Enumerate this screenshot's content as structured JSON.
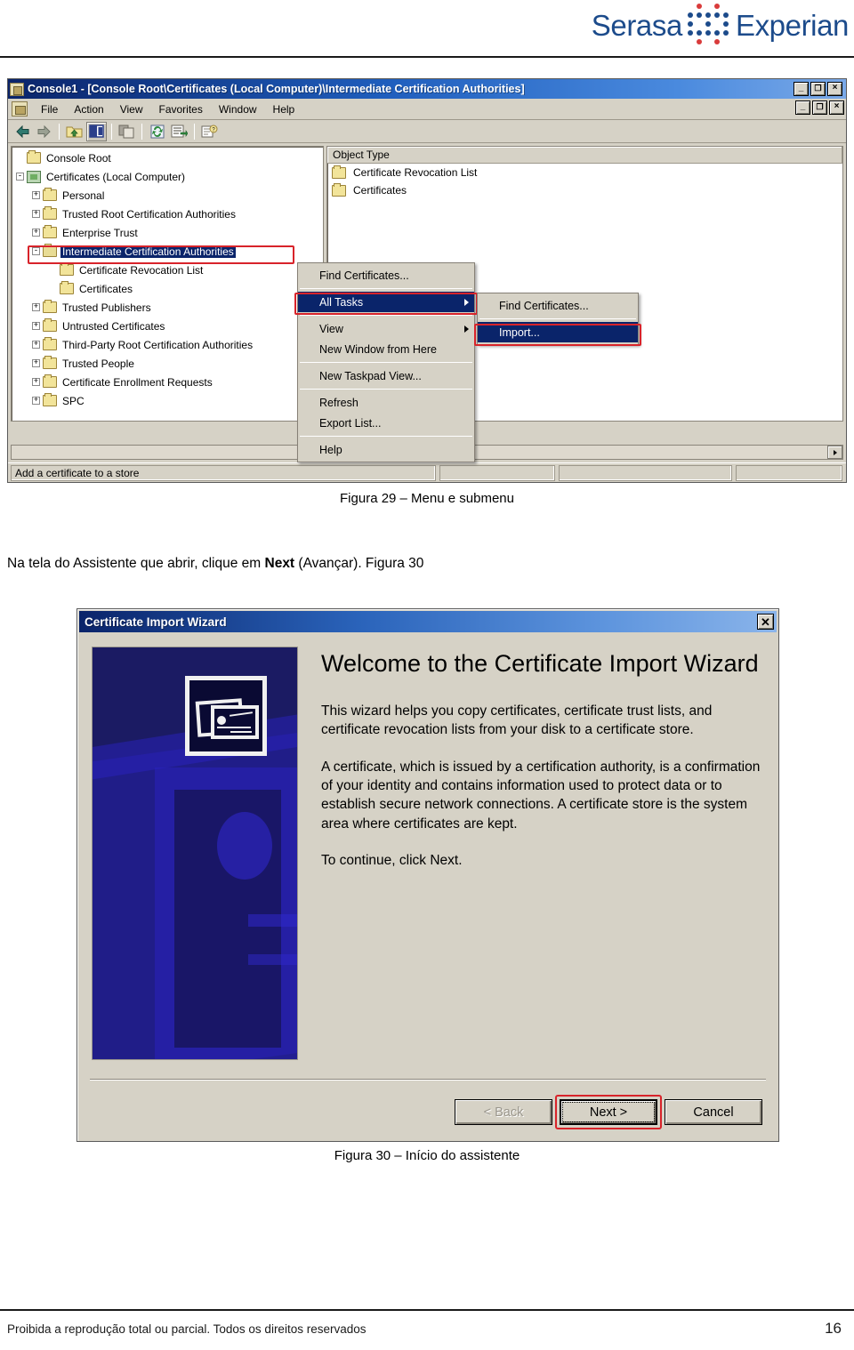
{
  "brand": {
    "word1": "Serasa",
    "word2": "Experian",
    "color_blue": "#1c4b8b",
    "color_red": "#d93b3b"
  },
  "figure29": {
    "window": {
      "title": "Console1 - [Console Root\\Certificates (Local Computer)\\Intermediate Certification Authorities]",
      "minimize": "_",
      "maximize": "❐",
      "close": "×",
      "mdi_minimize": "_",
      "mdi_restore": "❐",
      "mdi_close": "×"
    },
    "menubar": [
      {
        "label": "File"
      },
      {
        "label": "Action"
      },
      {
        "label": "View"
      },
      {
        "label": "Favorites"
      },
      {
        "label": "Window"
      },
      {
        "label": "Help"
      }
    ],
    "toolbar": [
      {
        "name": "back-icon"
      },
      {
        "name": "forward-icon"
      },
      {
        "name": "up-one-level-icon"
      },
      {
        "name": "show-hide-console-tree-icon"
      },
      {
        "name": "copy-icon"
      },
      {
        "name": "refresh-icon"
      },
      {
        "name": "export-list-icon"
      },
      {
        "name": "help-icon"
      }
    ],
    "tree": [
      {
        "label": "Console Root",
        "indent": 0,
        "plug": "",
        "icon": "folder"
      },
      {
        "label": "Certificates (Local Computer)",
        "indent": 0,
        "plug": "-",
        "icon": "cert"
      },
      {
        "label": "Personal",
        "indent": 1,
        "plug": "+",
        "icon": "folder"
      },
      {
        "label": "Trusted Root Certification Authorities",
        "indent": 1,
        "plug": "+",
        "icon": "folder"
      },
      {
        "label": "Enterprise Trust",
        "indent": 1,
        "plug": "+",
        "icon": "folder"
      },
      {
        "label": "Intermediate Certification Authorities",
        "indent": 1,
        "plug": "-",
        "icon": "folder",
        "selected": true
      },
      {
        "label": "Certificate Revocation List",
        "indent": 2,
        "plug": "",
        "icon": "folder"
      },
      {
        "label": "Certificates",
        "indent": 2,
        "plug": "",
        "icon": "folder"
      },
      {
        "label": "Trusted Publishers",
        "indent": 1,
        "plug": "+",
        "icon": "folder"
      },
      {
        "label": "Untrusted Certificates",
        "indent": 1,
        "plug": "+",
        "icon": "folder"
      },
      {
        "label": "Third-Party Root Certification Authorities",
        "indent": 1,
        "plug": "+",
        "icon": "folder"
      },
      {
        "label": "Trusted People",
        "indent": 1,
        "plug": "+",
        "icon": "folder"
      },
      {
        "label": "Certificate Enrollment Requests",
        "indent": 1,
        "plug": "+",
        "icon": "folder"
      },
      {
        "label": "SPC",
        "indent": 1,
        "plug": "+",
        "icon": "folder"
      }
    ],
    "list": {
      "column_header": "Object Type",
      "rows": [
        {
          "label": "Certificate Revocation List"
        },
        {
          "label": "Certificates"
        }
      ]
    },
    "context_menu": [
      {
        "label": "Find Certificates...",
        "type": "item"
      },
      {
        "type": "sep"
      },
      {
        "label": "All Tasks",
        "type": "item",
        "submenu": true,
        "highlighted": true
      },
      {
        "type": "sep"
      },
      {
        "label": "View",
        "type": "item",
        "submenu": true
      },
      {
        "label": "New Window from Here",
        "type": "item"
      },
      {
        "type": "sep"
      },
      {
        "label": "New Taskpad View...",
        "type": "item"
      },
      {
        "type": "sep"
      },
      {
        "label": "Refresh",
        "type": "item"
      },
      {
        "label": "Export List...",
        "type": "item"
      },
      {
        "type": "sep"
      },
      {
        "label": "Help",
        "type": "item"
      }
    ],
    "submenu": [
      {
        "label": "Find Certificates...",
        "highlighted": false
      },
      {
        "label": "Import...",
        "highlighted": true
      }
    ],
    "statusbar": "Add a certificate to a store",
    "scroll_right_arrow": "▶"
  },
  "caption29": "Figura 29 – Menu e submenu",
  "bodytext": {
    "part1": "Na tela do Assistente que abrir, clique em ",
    "bold": "Next",
    "part2": " (Avançar). Figura 30"
  },
  "figure30": {
    "title": "Certificate Import Wizard",
    "close": "✕",
    "heading": "Welcome to the Certificate Import Wizard",
    "paragraphs": [
      "This wizard helps you copy certificates, certificate trust lists, and certificate revocation lists from your disk to a certificate store.",
      "A certificate, which is issued by a certification authority, is a confirmation of your identity and contains information used to protect data or to establish secure network connections. A certificate store is the system area where certificates are kept.",
      "To continue, click Next."
    ],
    "buttons": {
      "back": "< Back",
      "next": "Next >",
      "cancel": "Cancel"
    }
  },
  "caption30": "Figura 30 – Início do assistente",
  "footer": {
    "text": "Proibida a reprodução total ou parcial. Todos os direitos reservados",
    "page": "16"
  }
}
